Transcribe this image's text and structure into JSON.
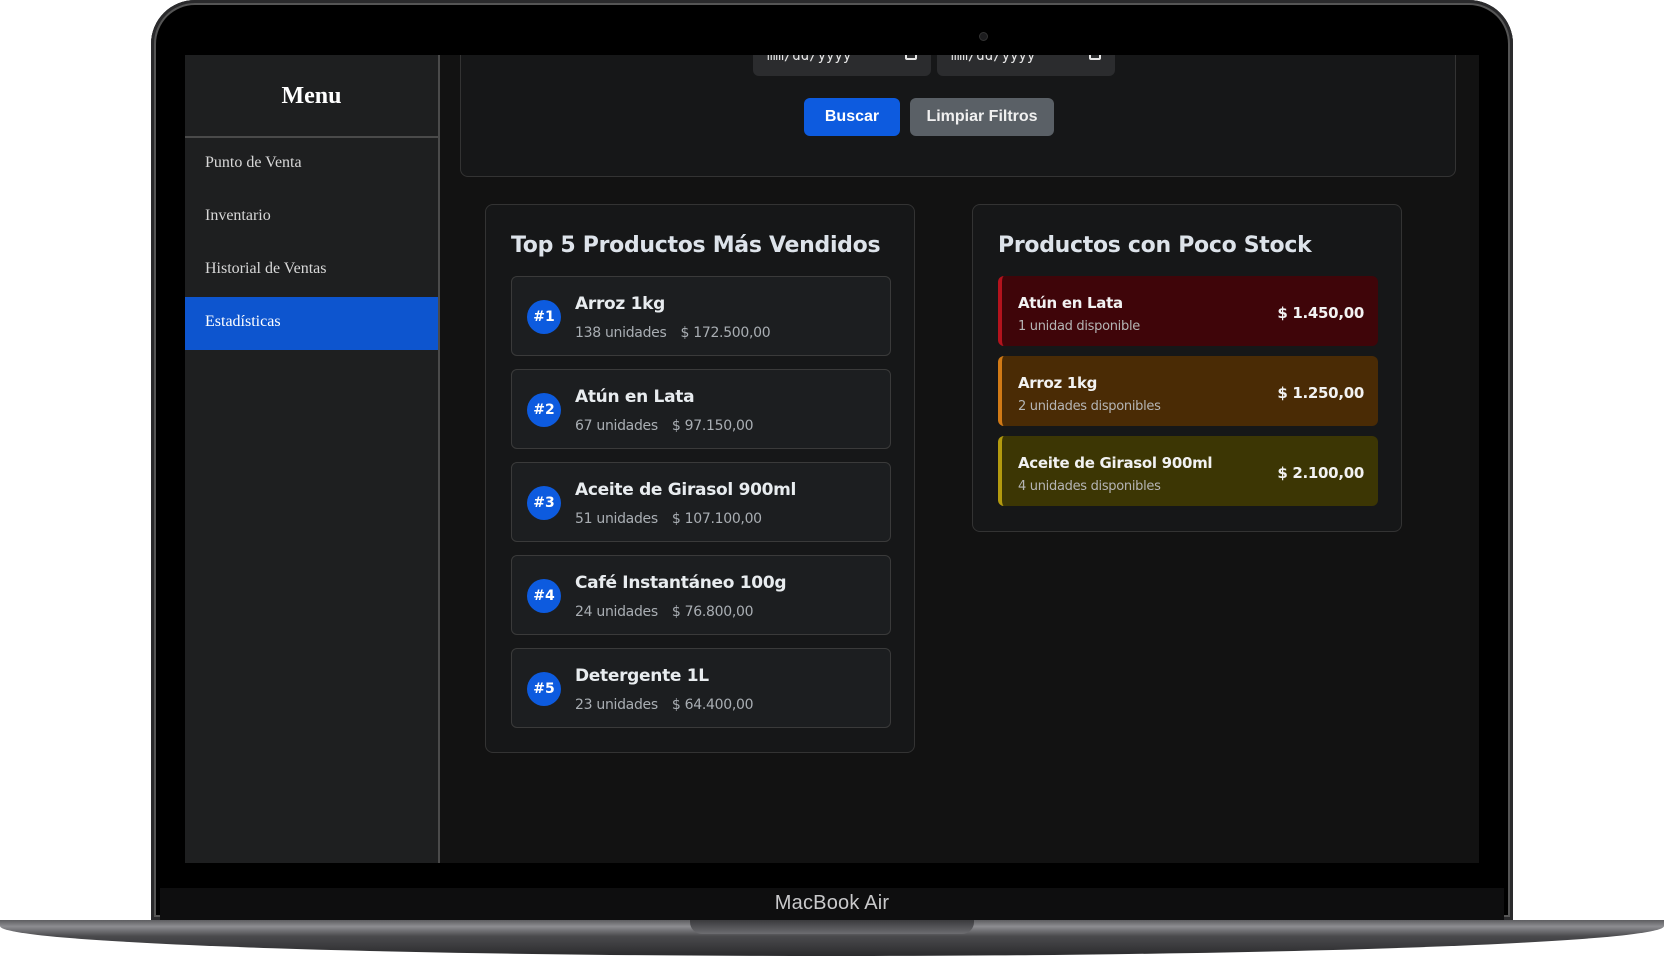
{
  "device": {
    "label": "MacBook Air"
  },
  "sidebar": {
    "title": "Menu",
    "items": [
      {
        "label": "Punto de Venta",
        "active": false
      },
      {
        "label": "Inventario",
        "active": false
      },
      {
        "label": "Historial de Ventas",
        "active": false
      },
      {
        "label": "Estadísticas",
        "active": true
      }
    ]
  },
  "filters": {
    "date_from": {
      "value": "mm/dd/yyyy"
    },
    "date_to": {
      "value": "mm/dd/yyyy"
    },
    "search_label": "Buscar",
    "clear_label": "Limpiar Filtros"
  },
  "top_products": {
    "title": "Top 5 Productos Más Vendidos",
    "items": [
      {
        "rank": "#1",
        "name": "Arroz 1kg",
        "units": "138 unidades",
        "total": "$ 172.500,00"
      },
      {
        "rank": "#2",
        "name": "Atún en Lata",
        "units": "67 unidades",
        "total": "$ 97.150,00"
      },
      {
        "rank": "#3",
        "name": "Aceite de Girasol 900ml",
        "units": "51 unidades",
        "total": "$ 107.100,00"
      },
      {
        "rank": "#4",
        "name": "Café Instantáneo 100g",
        "units": "24 unidades",
        "total": "$ 76.800,00"
      },
      {
        "rank": "#5",
        "name": "Detergente 1L",
        "units": "23 unidades",
        "total": "$ 64.400,00"
      }
    ]
  },
  "low_stock": {
    "title": "Productos con Poco Stock",
    "items": [
      {
        "name": "Atún en Lata",
        "available": "1 unidad disponible",
        "price": "$ 1.450,00",
        "bg": "#3f0509",
        "border": "#b3131d"
      },
      {
        "name": "Arroz 1kg",
        "available": "2 unidades disponibles",
        "price": "$ 1.250,00",
        "bg": "#4a2b05",
        "border": "#d17a16"
      },
      {
        "name": "Aceite de Girasol 900ml",
        "available": "4 unidades disponibles",
        "price": "$ 2.100,00",
        "bg": "#3c3604",
        "border": "#b39a0f"
      }
    ]
  },
  "colors": {
    "accent": "#0d5bdf",
    "sidebar_active": "#0d55cf",
    "background": "#121212"
  }
}
